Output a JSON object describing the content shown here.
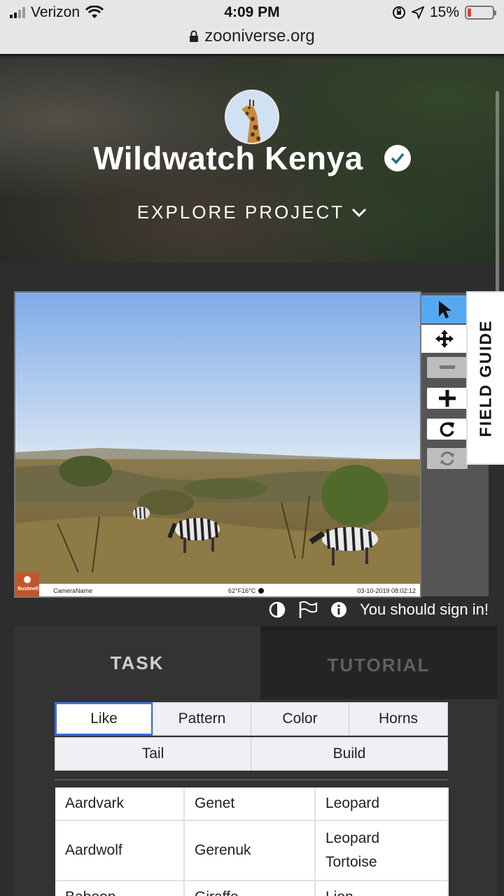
{
  "status_bar": {
    "carrier": "Verizon",
    "time": "4:09 PM",
    "battery": "15%",
    "battery_level": 0.15,
    "url": "zooniverse.org"
  },
  "project": {
    "title": "Wildwatch Kenya",
    "explore_label": "EXPLORE PROJECT"
  },
  "viewer": {
    "camera_brand": "Bushnell",
    "camera_name": "CameraName",
    "temperature": "62°F16°C",
    "timestamp": "03-10-2019 08:02:12"
  },
  "field_guide_label": "FIELD GUIDE",
  "sign_in_text": "You should sign in!",
  "tabs": {
    "task": "TASK",
    "tutorial": "TUTORIAL"
  },
  "filters": [
    {
      "label": "Like",
      "selected": true
    },
    {
      "label": "Pattern"
    },
    {
      "label": "Color"
    },
    {
      "label": "Horns"
    },
    {
      "label": "Tail"
    },
    {
      "label": "Build"
    }
  ],
  "species": [
    [
      "Aardvark",
      "Genet",
      "Leopard"
    ],
    [
      "Aardwolf",
      "Gerenuk",
      "Leopard Tortoise"
    ],
    [
      "Baboon",
      "Giraffe",
      "Lion"
    ]
  ],
  "colors": {
    "accent": "#56a9f0",
    "selected_border": "#3b6fd6",
    "battery_low": "#e53935"
  }
}
